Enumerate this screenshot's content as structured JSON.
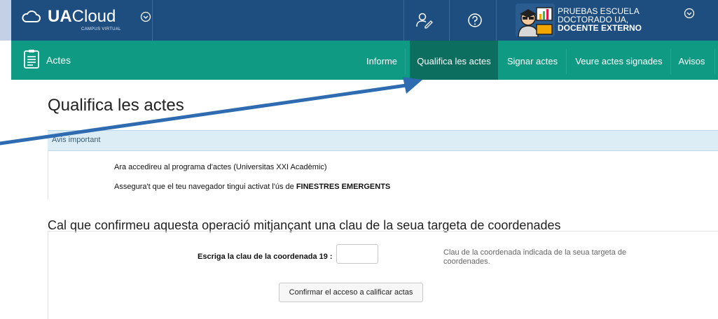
{
  "header": {
    "brand_bold": "UA",
    "brand_regular": "Cloud",
    "brand_sub": "CAMPUS VIRTUAL",
    "user_lines": [
      "PRUEBAS ESCUELA",
      "DOCTORADO UA,",
      "DOCENTE EXTERNO"
    ],
    "icons": [
      "cloud-logo-icon",
      "chevron-down-icon",
      "user-edit-icon",
      "help-icon",
      "user-avatar",
      "chevron-down-icon"
    ]
  },
  "nav": {
    "section_title": "Actes",
    "items": [
      "Informe",
      "Qualifica les actes",
      "Signar actes",
      "Veure actes signades",
      "Avisos"
    ],
    "active_index": 1
  },
  "page": {
    "title": "Qualifica les actes",
    "notice": {
      "header": "Avis important",
      "line1": "Ara accedireu al programa d'actes (Universitas XXI Acadèmic)",
      "line2_prefix": "Assegura't que el teu navegador tingui activat l'ús de ",
      "line2_bold": "FINESTRES EMERGENTS"
    },
    "confirm_heading": "Cal que confirmeu aquesta operació mitjançant una clau de la seua targeta de coordenades",
    "form": {
      "label": "Escriga la clau de la coordenada 19 :",
      "input_value": "",
      "help": "Clau de la coordenada indicada de la seua targeta de coordenades.",
      "button": "Confirmar el acceso a calificar actas"
    }
  },
  "colors": {
    "topbar": "#1e4e80",
    "navbar": "#0f9a84",
    "nav_active": "#0b6e5f",
    "notice_bg": "#dcedf6",
    "annotation_arrow": "#2e6bb0"
  }
}
